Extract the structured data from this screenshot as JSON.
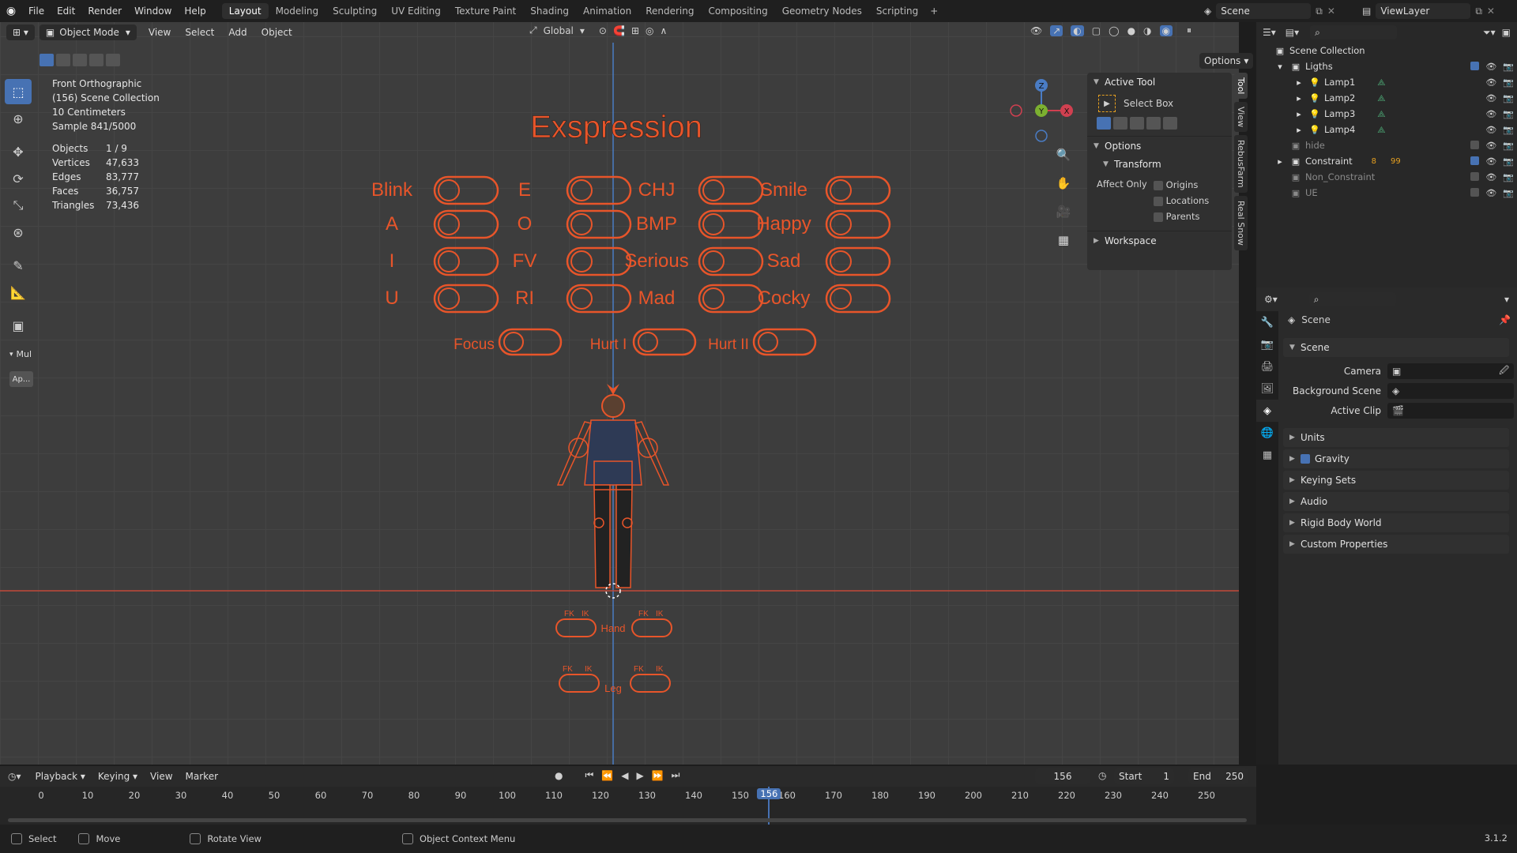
{
  "top_menu": {
    "items": [
      "File",
      "Edit",
      "Render",
      "Window",
      "Help"
    ]
  },
  "workspaces": [
    "Layout",
    "Modeling",
    "Sculpting",
    "UV Editing",
    "Texture Paint",
    "Shading",
    "Animation",
    "Rendering",
    "Compositing",
    "Geometry Nodes",
    "Scripting"
  ],
  "active_workspace": "Layout",
  "scene_name": "Scene",
  "view_layer": "ViewLayer",
  "viewport_header": {
    "mode": "Object Mode",
    "menus": [
      "View",
      "Select",
      "Add",
      "Object"
    ],
    "transform": "Global",
    "options": "Options"
  },
  "overlay_info": {
    "view": "Front Orthographic",
    "collection": "(156) Scene Collection",
    "scale": "10 Centimeters",
    "sample": "Sample 841/5000",
    "stats": [
      {
        "k": "Objects",
        "v": "1 / 9"
      },
      {
        "k": "Vertices",
        "v": "47,633"
      },
      {
        "k": "Edges",
        "v": "83,777"
      },
      {
        "k": "Faces",
        "v": "36,757"
      },
      {
        "k": "Triangles",
        "v": "73,436"
      }
    ]
  },
  "left_tools_extra": {
    "mul": "Mul",
    "ap": "Ap..."
  },
  "rig": {
    "title": "Exspression",
    "rows": [
      [
        "Blink",
        "E",
        "CHJ",
        "Smile"
      ],
      [
        "A",
        "O",
        "BMP",
        "Happy"
      ],
      [
        "I",
        "FV",
        "Serious",
        "Sad"
      ],
      [
        "U",
        "RI",
        "Mad",
        "Cocky"
      ]
    ],
    "bottom_row": [
      "Focus",
      "Hurt I",
      "Hurt II"
    ],
    "hand_label": "Hand",
    "leg_label": "Leg",
    "fk": "FK",
    "ik": "IK"
  },
  "npanel": {
    "tabs": [
      "Tool",
      "View",
      "RebusFarm",
      "Real Snow"
    ],
    "active_tool": "Active Tool",
    "select_box": "Select Box",
    "options": "Options",
    "transform": "Transform",
    "affect_only": "Affect Only",
    "origins": "Origins",
    "locations": "Locations",
    "parents": "Parents",
    "workspace": "Workspace"
  },
  "gizmo": {
    "z": "Z",
    "y": "Y",
    "x": "X"
  },
  "outliner": {
    "root": "Scene Collection",
    "items": [
      {
        "label": "Ligths",
        "level": 1,
        "type": "collection",
        "checked": true
      },
      {
        "label": "Lamp1",
        "level": 2,
        "type": "lamp"
      },
      {
        "label": "Lamp2",
        "level": 2,
        "type": "lamp"
      },
      {
        "label": "Lamp3",
        "level": 2,
        "type": "lamp"
      },
      {
        "label": "Lamp4",
        "level": 2,
        "type": "lamp"
      },
      {
        "label": "hide",
        "level": 1,
        "type": "collection",
        "checked": false
      },
      {
        "label": "Constraint",
        "level": 1,
        "type": "collection",
        "checked": true
      },
      {
        "label": "Non_Constraint",
        "level": 1,
        "type": "collection",
        "checked": false
      },
      {
        "label": "UE",
        "level": 1,
        "type": "collection",
        "checked": false
      }
    ],
    "constraint_counts": {
      "a": "8",
      "b": "99"
    }
  },
  "properties": {
    "header": "Scene",
    "section": "Scene",
    "camera": "Camera",
    "background_scene": "Background Scene",
    "active_clip": "Active Clip",
    "sections": [
      "Units",
      "Gravity",
      "Keying Sets",
      "Audio",
      "Rigid Body World",
      "Custom Properties"
    ]
  },
  "timeline": {
    "menus": [
      "Playback",
      "Keying",
      "View",
      "Marker"
    ],
    "current_frame": "156",
    "start_label": "Start",
    "start": "1",
    "end_label": "End",
    "end": "250",
    "ticks": [
      "0",
      "10",
      "20",
      "30",
      "40",
      "50",
      "60",
      "70",
      "80",
      "90",
      "100",
      "110",
      "120",
      "130",
      "140",
      "150",
      "160",
      "170",
      "180",
      "190",
      "200",
      "210",
      "220",
      "230",
      "240",
      "250"
    ]
  },
  "statusbar": {
    "items": [
      "Select",
      "Move",
      "Rotate View",
      "Object Context Menu"
    ],
    "version": "3.1.2"
  },
  "colors": {
    "accent": "#4772b3",
    "rig": "#e8552a",
    "bg": "#3d3d3d"
  }
}
